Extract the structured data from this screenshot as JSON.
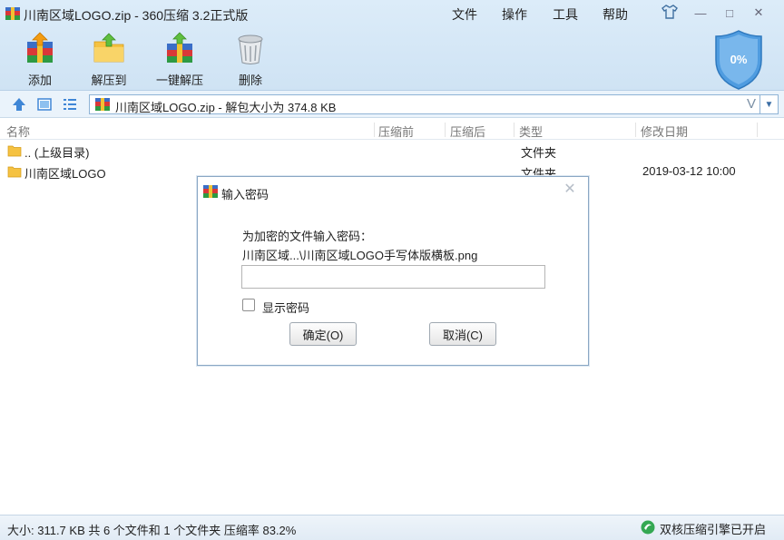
{
  "window": {
    "title": "川南区域LOGO.zip - 360压缩 3.2正式版",
    "menus": [
      "文件",
      "操作",
      "工具",
      "帮助"
    ],
    "buttons": {
      "minimize": "—",
      "maximize": "□",
      "close": "✕"
    }
  },
  "toolbar": {
    "add": "添加",
    "extract_to": "解压到",
    "one_click_extract": "一键解压",
    "delete": "删除"
  },
  "shield": {
    "percent": "0%"
  },
  "address": {
    "path": "川南区域LOGO.zip - 解包大小为 374.8 KB",
    "history_glyph": "V"
  },
  "columns": {
    "name": "名称",
    "before": "压缩前",
    "after": "压缩后",
    "type": "类型",
    "modified": "修改日期"
  },
  "rows": [
    {
      "name": ".. (上级目录)",
      "type": "文件夹",
      "modified": ""
    },
    {
      "name": "川南区域LOGO",
      "type": "文件夹",
      "modified": "2019-03-12 10:00"
    }
  ],
  "status": {
    "summary": "大小: 311.7 KB 共 6 个文件和 1 个文件夹 压缩率 83.2%",
    "engine": "双核压缩引擎已开启"
  },
  "dialog": {
    "title": "输入密码",
    "prompt": "为加密的文件输入密码：",
    "path": "川南区域...\\川南区域LOGO手写体版横板.png",
    "password_value": "",
    "show_password": "显示密码",
    "ok": "确定(O)",
    "cancel": "取消(C)"
  }
}
